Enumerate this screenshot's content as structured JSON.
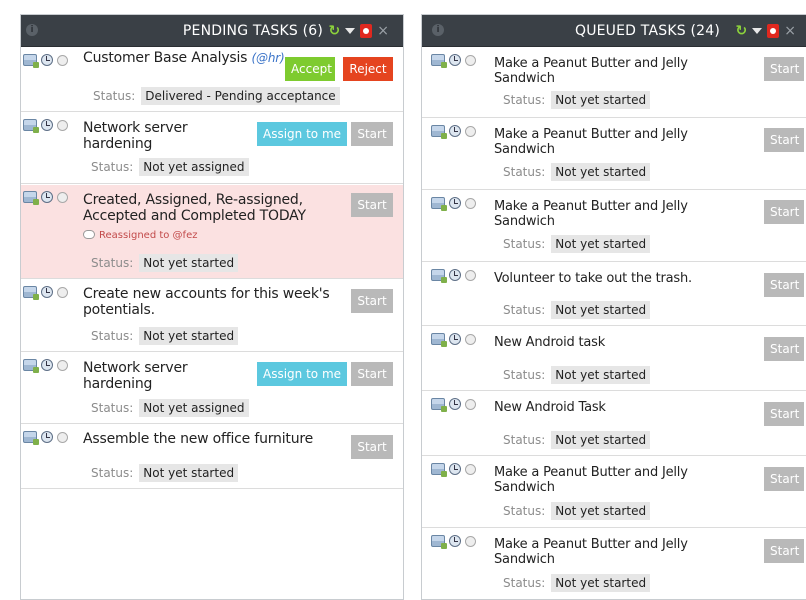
{
  "pending": {
    "title": "PENDING TASKS (6)",
    "status_label": "Status:",
    "tasks": [
      {
        "title": "Customer Base Analysis",
        "mention": "(@hr)",
        "status": "Delivered - Pending acceptance",
        "accept_label": "Accept",
        "reject_label": "Reject"
      },
      {
        "title": "Network server hardening",
        "status": "Not yet assigned",
        "assign_label": "Assign to me",
        "start_label": "Start"
      },
      {
        "title": "Created, Assigned, Re-assigned, Accepted and Completed TODAY",
        "note": "Reassigned to @fez",
        "status": "Not yet started",
        "start_label": "Start"
      },
      {
        "title": "Create new accounts for this week's potentials.",
        "status": "Not yet started",
        "start_label": "Start"
      },
      {
        "title": "Network server hardening",
        "status": "Not yet assigned",
        "assign_label": "Assign to me",
        "start_label": "Start"
      },
      {
        "title": "Assemble the new office furniture",
        "status": "Not yet started",
        "start_label": "Start"
      }
    ]
  },
  "queued": {
    "title": "QUEUED TASKS (24)",
    "status_label": "Status:",
    "tasks": [
      {
        "title": "Make a Peanut Butter and Jelly Sandwich",
        "status": "Not yet started",
        "start_label": "Start"
      },
      {
        "title": "Make a Peanut Butter and Jelly Sandwich",
        "status": "Not yet started",
        "start_label": "Start"
      },
      {
        "title": "Make a Peanut Butter and Jelly Sandwich",
        "status": "Not yet started",
        "start_label": "Start"
      },
      {
        "title": "Volunteer to take out the trash.",
        "status": "Not yet started",
        "start_label": "Start"
      },
      {
        "title": "New Android task",
        "status": "Not yet started",
        "start_label": "Start"
      },
      {
        "title": "New Android Task",
        "status": "Not yet started",
        "start_label": "Start"
      },
      {
        "title": "Make a Peanut Butter and Jelly Sandwich",
        "status": "Not yet started",
        "start_label": "Start"
      },
      {
        "title": "Make a Peanut Butter and Jelly Sandwich",
        "status": "Not yet started",
        "start_label": "Start"
      }
    ]
  },
  "colors": {
    "header_bg": "#3a4046",
    "highlight_row": "#fbe1e1",
    "start_button": "#b9b9b9",
    "assign_button": "#5cc8df",
    "accept_button": "#7ecb2f",
    "reject_button": "#e5441f",
    "refresh_icon": "#8cd23c",
    "pdf_icon": "#e0281f",
    "mention_text": "#3b74c8"
  },
  "icons": {
    "header": [
      "info-icon",
      "refresh-icon",
      "menu-dropdown-icon",
      "pdf-icon",
      "close-icon"
    ],
    "row": [
      "task-type-icon",
      "clock-icon",
      "status-check-icon"
    ]
  }
}
